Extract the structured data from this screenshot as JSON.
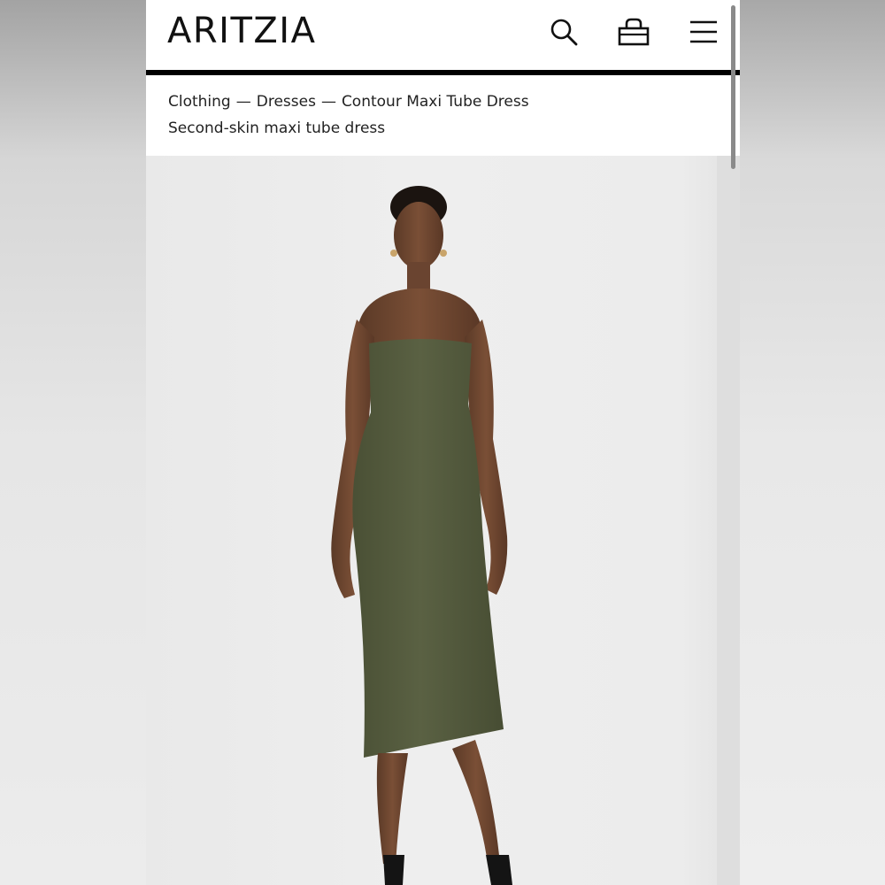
{
  "header": {
    "logo_text": "ARITZIA",
    "icons": {
      "search": "search-icon",
      "bag": "shopping-bag-icon",
      "menu": "hamburger-menu-icon"
    }
  },
  "breadcrumb": {
    "items": [
      "Clothing",
      "Dresses",
      "Contour Maxi Tube Dress"
    ],
    "separator": "—"
  },
  "product": {
    "subtitle": "Second-skin maxi tube dress",
    "dress_color": "#545a3e"
  },
  "colors": {
    "header_bg": "#ffffff",
    "rule": "#000000",
    "text": "#222222"
  }
}
